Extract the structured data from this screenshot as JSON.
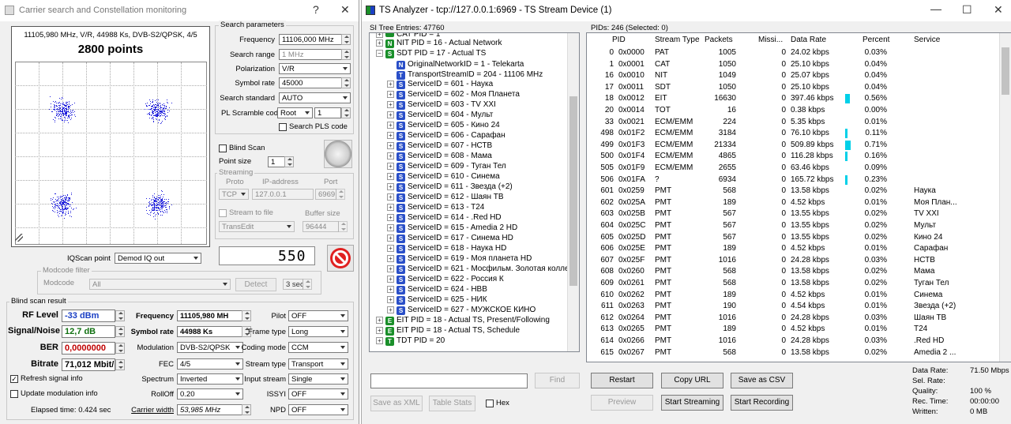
{
  "left_window": {
    "title": "Carrier search and Constellation monitoring",
    "help": "?",
    "close": "✕",
    "plot": {
      "info": "11105,980 MHz, V/R, 44988 Ks, DVB-S2/QPSK, 4/5",
      "points_label": "2800 points",
      "clusters": [
        {
          "name": "top-left"
        },
        {
          "name": "top-right"
        },
        {
          "name": "bottom-left"
        },
        {
          "name": "bottom-right"
        }
      ]
    },
    "iqscan": {
      "label": "IQScan point",
      "value": "Demod IQ out"
    },
    "counter": "550",
    "search": {
      "title": "Search parameters",
      "frequency_label": "Frequency",
      "frequency": "11106,000 MHz",
      "range_label": "Search range",
      "range": "1 MHz",
      "pol_label": "Polarization",
      "pol": "V/R",
      "sr_label": "Symbol rate",
      "sr": "45000",
      "std_label": "Search standard",
      "std": "AUTO",
      "pls_label": "PL Scramble code",
      "pls_mode": "Root",
      "pls_val": "1",
      "search_pls": "Search PLS code"
    },
    "blind_scan": "Blind Scan",
    "point_size_label": "Point size",
    "point_size": "1",
    "streaming": {
      "title": "Streaming",
      "proto_label": "Proto",
      "proto": "TCP",
      "ip_label": "IP-address",
      "ip": "127.0.0.1",
      "port_label": "Port",
      "port": "6969",
      "stf": "Stream to file",
      "buf_label": "Buffer size",
      "file": "TransEdit",
      "buf": "96444"
    },
    "modcode": {
      "title": "Modcode filter",
      "label": "Modcode",
      "value": "All",
      "detect": "Detect",
      "sec": "3 sec"
    },
    "result": {
      "title": "Blind scan result",
      "rf_label": "RF Level",
      "rf": "-33 dBm",
      "sn_label": "Signal/Noise",
      "sn": "12,7 dB",
      "ber_label": "BER",
      "ber": "0,0000000",
      "br_label": "Bitrate",
      "br": "71,012 Mbit/",
      "freq_label": "Frequency",
      "freq": "11105,980 MH",
      "srl": "Symbol rate",
      "srv": "44988 Ks",
      "mod_label": "Modulation",
      "mod": "DVB-S2/QPSK",
      "fec_label": "FEC",
      "fec": "4/5",
      "spec_label": "Spectrum",
      "spec": "Inverted",
      "ro_label": "RollOff",
      "ro": "0.20",
      "cw_label": "Carrier width",
      "cw": "53,985 MHz",
      "pilot_label": "Pilot",
      "pilot": "OFF",
      "ft_label": "Frame type",
      "ft": "Long",
      "cm_label": "Coding mode",
      "cm": "CCM",
      "st_label": "Stream type",
      "st": "Transport",
      "is_label": "Input stream",
      "is": "Single",
      "issyi_label": "ISSYI",
      "issyi": "OFF",
      "npd_label": "NPD",
      "npd": "OFF",
      "refresh": "Refresh signal info",
      "update_mod": "Update modulation info",
      "elapsed": "Elapsed time: 0.424 sec"
    },
    "colors": {
      "dots": "#1c1cdc",
      "rf": "#1a3fc4",
      "sn": "#107010",
      "ber": "#c00000"
    }
  },
  "right_window": {
    "title": "TS Analyzer - tcp://127.0.0.1:6969 - TS Stream Device (1)",
    "minimize": "—",
    "maximize": "☐",
    "close": "✕",
    "si_label": "SI Tree Entries: 47760",
    "pids_label": "PIDs: 246",
    "selected_label": "(Selected: 0)",
    "tree": [
      {
        "d": 0,
        "e": "⊞",
        "c": "#1a8f2a",
        "t": "CAT PID = 1"
      },
      {
        "d": 0,
        "e": "⊞",
        "c": "#1a8f2a",
        "i": "N",
        "t": "NIT PID = 16 - Actual Network"
      },
      {
        "d": 0,
        "e": "⊟",
        "c": "#1a8f2a",
        "i": "S",
        "t": "SDT PID = 17 - Actual TS"
      },
      {
        "d": 1,
        "e": "",
        "c": "#2a4fc8",
        "i": "N",
        "t": "OriginalNetworkID = 1 - Telekarta"
      },
      {
        "d": 1,
        "e": "",
        "c": "#2a4fc8",
        "i": "T",
        "t": "TransportStreamID = 204 - 11106 MHz"
      },
      {
        "d": 1,
        "e": "⊞",
        "c": "#2a4fc8",
        "i": "S",
        "t": "ServiceID = 601 - Наука"
      },
      {
        "d": 1,
        "e": "⊞",
        "c": "#2a4fc8",
        "i": "S",
        "t": "ServiceID = 602 - Моя Планета"
      },
      {
        "d": 1,
        "e": "⊞",
        "c": "#2a4fc8",
        "i": "S",
        "t": "ServiceID = 603 - TV XXI"
      },
      {
        "d": 1,
        "e": "⊞",
        "c": "#2a4fc8",
        "i": "S",
        "t": "ServiceID = 604 - Мульт"
      },
      {
        "d": 1,
        "e": "⊞",
        "c": "#2a4fc8",
        "i": "S",
        "t": "ServiceID = 605 - Кино 24"
      },
      {
        "d": 1,
        "e": "⊞",
        "c": "#2a4fc8",
        "i": "S",
        "t": "ServiceID = 606 - Сарафан"
      },
      {
        "d": 1,
        "e": "⊞",
        "c": "#2a4fc8",
        "i": "S",
        "t": "ServiceID = 607 - НСТВ"
      },
      {
        "d": 1,
        "e": "⊞",
        "c": "#2a4fc8",
        "i": "S",
        "t": "ServiceID = 608 - Мама"
      },
      {
        "d": 1,
        "e": "⊞",
        "c": "#2a4fc8",
        "i": "S",
        "t": "ServiceID = 609 - Туган Тел"
      },
      {
        "d": 1,
        "e": "⊞",
        "c": "#2a4fc8",
        "i": "S",
        "t": "ServiceID = 610 - Синема"
      },
      {
        "d": 1,
        "e": "⊞",
        "c": "#2a4fc8",
        "i": "S",
        "t": "ServiceID = 611 - Звезда (+2)"
      },
      {
        "d": 1,
        "e": "⊞",
        "c": "#2a4fc8",
        "i": "S",
        "t": "ServiceID = 612 - Шаян ТВ"
      },
      {
        "d": 1,
        "e": "⊞",
        "c": "#2a4fc8",
        "i": "S",
        "t": "ServiceID = 613 - T24"
      },
      {
        "d": 1,
        "e": "⊞",
        "c": "#2a4fc8",
        "i": "S",
        "t": "ServiceID = 614 - .Red HD"
      },
      {
        "d": 1,
        "e": "⊞",
        "c": "#2a4fc8",
        "i": "S",
        "t": "ServiceID = 615 - Amedia 2 HD"
      },
      {
        "d": 1,
        "e": "⊞",
        "c": "#2a4fc8",
        "i": "S",
        "t": "ServiceID = 617 - Синема HD"
      },
      {
        "d": 1,
        "e": "⊞",
        "c": "#2a4fc8",
        "i": "S",
        "t": "ServiceID = 618 - Наука HD"
      },
      {
        "d": 1,
        "e": "⊞",
        "c": "#2a4fc8",
        "i": "S",
        "t": "ServiceID = 619 - Моя планета HD"
      },
      {
        "d": 1,
        "e": "⊞",
        "c": "#2a4fc8",
        "i": "S",
        "t": "ServiceID = 621 - Мосфильм. Золотая коллекц"
      },
      {
        "d": 1,
        "e": "⊞",
        "c": "#2a4fc8",
        "i": "S",
        "t": "ServiceID = 622 - Россия К"
      },
      {
        "d": 1,
        "e": "⊞",
        "c": "#2a4fc8",
        "i": "S",
        "t": "ServiceID = 624 - НВВ"
      },
      {
        "d": 1,
        "e": "⊞",
        "c": "#2a4fc8",
        "i": "S",
        "t": "ServiceID = 625 - НИК"
      },
      {
        "d": 1,
        "e": "⊞",
        "c": "#2a4fc8",
        "i": "S",
        "t": "ServiceID = 627 - МУЖСКОЕ КИНО"
      },
      {
        "d": 0,
        "e": "⊞",
        "c": "#1a8f2a",
        "i": "E",
        "t": "EIT PID = 18 - Actual TS, Present/Following"
      },
      {
        "d": 0,
        "e": "⊞",
        "c": "#1a8f2a",
        "i": "E",
        "t": "EIT PID = 18 - Actual TS, Schedule"
      },
      {
        "d": 0,
        "e": "⊞",
        "c": "#1a8f2a",
        "i": "T",
        "t": "TDT PID = 20"
      }
    ],
    "columns": [
      "PID",
      "Stream Type",
      "Packets",
      "Missi...",
      "Data Rate",
      "Percent",
      "Service"
    ],
    "rows": [
      [
        "0",
        "0x0000",
        "PAT",
        "1005",
        "0",
        "24.02 kbps",
        "0.03%",
        ""
      ],
      [
        "1",
        "0x0001",
        "CAT",
        "1050",
        "0",
        "25.10 kbps",
        "0.04%",
        ""
      ],
      [
        "16",
        "0x0010",
        "NIT",
        "1049",
        "0",
        "25.07 kbps",
        "0.04%",
        ""
      ],
      [
        "17",
        "0x0011",
        "SDT",
        "1050",
        "0",
        "25.10 kbps",
        "0.04%",
        ""
      ],
      [
        "18",
        "0x0012",
        "EIT",
        "16630",
        "0",
        "397.46 kbps",
        "0.56%",
        ""
      ],
      [
        "20",
        "0x0014",
        "TOT",
        "16",
        "0",
        "0.38 kbps",
        "0.00%",
        ""
      ],
      [
        "33",
        "0x0021",
        "ECM/EMM",
        "224",
        "0",
        "5.35 kbps",
        "0.01%",
        ""
      ],
      [
        "498",
        "0x01F2",
        "ECM/EMM",
        "3184",
        "0",
        "76.10 kbps",
        "0.11%",
        ""
      ],
      [
        "499",
        "0x01F3",
        "ECM/EMM",
        "21334",
        "0",
        "509.89 kbps",
        "0.71%",
        ""
      ],
      [
        "500",
        "0x01F4",
        "ECM/EMM",
        "4865",
        "0",
        "116.28 kbps",
        "0.16%",
        ""
      ],
      [
        "505",
        "0x01F9",
        "ECM/EMM",
        "2655",
        "0",
        "63.46 kbps",
        "0.09%",
        ""
      ],
      [
        "506",
        "0x01FA",
        "?",
        "6934",
        "0",
        "165.72 kbps",
        "0.23%",
        ""
      ],
      [
        "601",
        "0x0259",
        "PMT",
        "568",
        "0",
        "13.58 kbps",
        "0.02%",
        "Наука"
      ],
      [
        "602",
        "0x025A",
        "PMT",
        "189",
        "0",
        "4.52 kbps",
        "0.01%",
        "Моя План..."
      ],
      [
        "603",
        "0x025B",
        "PMT",
        "567",
        "0",
        "13.55 kbps",
        "0.02%",
        "TV XXI"
      ],
      [
        "604",
        "0x025C",
        "PMT",
        "567",
        "0",
        "13.55 kbps",
        "0.02%",
        "Мульт"
      ],
      [
        "605",
        "0x025D",
        "PMT",
        "567",
        "0",
        "13.55 kbps",
        "0.02%",
        "Кино 24"
      ],
      [
        "606",
        "0x025E",
        "PMT",
        "189",
        "0",
        "4.52 kbps",
        "0.01%",
        "Сарафан"
      ],
      [
        "607",
        "0x025F",
        "PMT",
        "1016",
        "0",
        "24.28 kbps",
        "0.03%",
        "НСТВ"
      ],
      [
        "608",
        "0x0260",
        "PMT",
        "568",
        "0",
        "13.58 kbps",
        "0.02%",
        "Мама"
      ],
      [
        "609",
        "0x0261",
        "PMT",
        "568",
        "0",
        "13.58 kbps",
        "0.02%",
        "Туган Тел"
      ],
      [
        "610",
        "0x0262",
        "PMT",
        "189",
        "0",
        "4.52 kbps",
        "0.01%",
        "Синема"
      ],
      [
        "611",
        "0x0263",
        "PMT",
        "190",
        "0",
        "4.54 kbps",
        "0.01%",
        "Звезда (+2)"
      ],
      [
        "612",
        "0x0264",
        "PMT",
        "1016",
        "0",
        "24.28 kbps",
        "0.03%",
        "Шаян ТВ"
      ],
      [
        "613",
        "0x0265",
        "PMT",
        "189",
        "0",
        "4.52 kbps",
        "0.01%",
        "T24"
      ],
      [
        "614",
        "0x0266",
        "PMT",
        "1016",
        "0",
        "24.28 kbps",
        "0.03%",
        ".Red HD"
      ],
      [
        "615",
        "0x0267",
        "PMT",
        "568",
        "0",
        "13.58 kbps",
        "0.02%",
        "Amedia 2 ..."
      ]
    ],
    "find": "Find",
    "save_xml": "Save as XML",
    "table_stats": "Table Stats",
    "hex": "Hex",
    "restart": "Restart",
    "copy_url": "Copy URL",
    "save_csv": "Save as CSV",
    "preview": "Preview",
    "start_streaming": "Start Streaming",
    "start_recording": "Start Recording",
    "stats": [
      [
        "Data Rate:",
        "71.50 Mbps"
      ],
      [
        "Sel. Rate:",
        ""
      ],
      [
        "Quality:",
        "100 %"
      ],
      [
        "Rec. Time:",
        "00:00:00"
      ],
      [
        "Written:",
        "0 MB"
      ]
    ],
    "colors": {
      "bar": "#00d0e8",
      "tree_green": "#1a8f2a",
      "tree_blue": "#2a4fc8"
    }
  }
}
